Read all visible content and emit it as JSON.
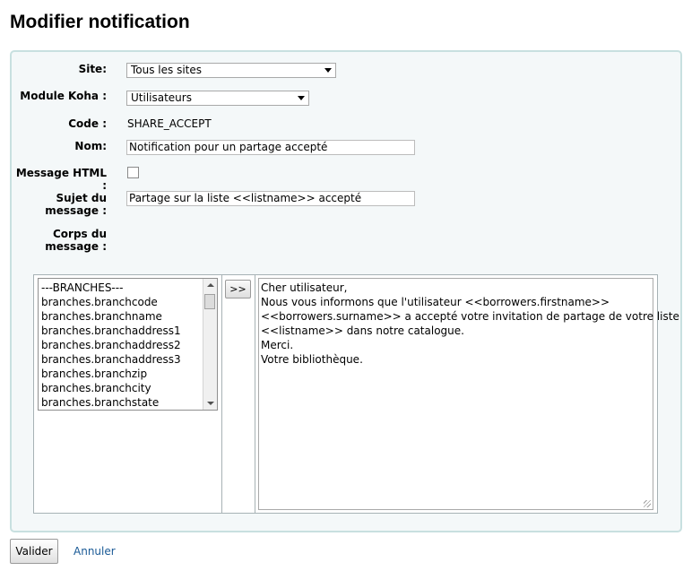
{
  "page": {
    "title": "Modifier notification"
  },
  "form": {
    "site": {
      "label": "Site:",
      "value": "Tous les sites"
    },
    "module": {
      "label": "Module Koha :",
      "value": "Utilisateurs"
    },
    "code": {
      "label": "Code :",
      "value": "SHARE_ACCEPT"
    },
    "nom": {
      "label": "Nom:",
      "value": "Notification pour un partage accepté"
    },
    "html": {
      "label": "Message HTML :",
      "checked": false
    },
    "sujet": {
      "label_line1": "Sujet du",
      "label_line2": "message :",
      "value": "Partage sur la liste <<listname>> accepté"
    },
    "corps": {
      "label_line1": "Corps du",
      "label_line2": "message :"
    }
  },
  "fields_list": [
    "---BRANCHES---",
    "branches.branchcode",
    "branches.branchname",
    "branches.branchaddress1",
    "branches.branchaddress2",
    "branches.branchaddress3",
    "branches.branchzip",
    "branches.branchcity",
    "branches.branchstate"
  ],
  "insert_button": ">>",
  "body_lines": [
    "Cher utilisateur,",
    "Nous vous informons que l'utilisateur <<borrowers.firstname>>",
    "<<borrowers.surname>> a accepté votre invitation de partage de votre liste",
    "<<listname>> dans notre catalogue.",
    "Merci.",
    "Votre bibliothèque."
  ],
  "actions": {
    "submit": "Valider",
    "cancel": "Annuler"
  }
}
